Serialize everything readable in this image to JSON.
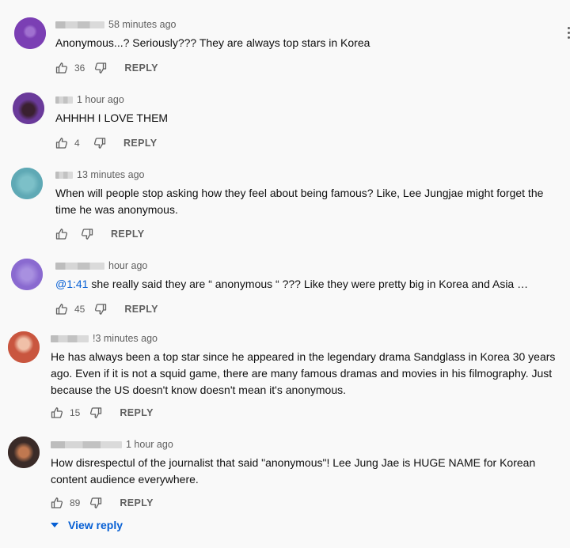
{
  "comments": [
    {
      "time": "58 minutes ago",
      "text": "Anonymous...? Seriously??? They are always top stars in Korea",
      "likes": "36",
      "reply_label": "REPLY",
      "avatar_color": "#7b3fb4"
    },
    {
      "time": "1 hour ago",
      "text": "AHHHH I LOVE THEM",
      "likes": "4",
      "reply_label": "REPLY",
      "avatar_color": "#6a3a9a"
    },
    {
      "time": "13 minutes ago",
      "text": "When will people stop asking how they feel about being famous? Like, Lee Jungjae might forget the\ntime he was anonymous.",
      "likes": "",
      "reply_label": "REPLY",
      "avatar_color": "#5fa9b5"
    },
    {
      "time": "hour ago",
      "timestamp_link": "@1:41",
      "text": " she really said they are “ anonymous “ ??? Like they were pretty big in Korea and Asia …",
      "likes": "45",
      "reply_label": "REPLY",
      "avatar_color": "#8a6ad0"
    },
    {
      "time": "!3 minutes ago",
      "text": "He has always been a top star since he appeared in the legendary drama Sandglass in Korea 30 years\nago. Even if it is not a squid game, there are many famous dramas and movies in his filmography. Just\nbecause the US doesn't know doesn't mean it's anonymous.",
      "likes": "15",
      "reply_label": "REPLY",
      "avatar_color": "#c9563f"
    },
    {
      "time": "1 hour ago",
      "text": "How disrespectul of the journalist that said \"anonymous\"! Lee Jung Jae is HUGE NAME for Korean\ncontent audience everywhere.",
      "likes": "89",
      "reply_label": "REPLY",
      "avatar_color": "#3a2b28"
    }
  ],
  "view_reply_label": "View reply",
  "icons": {
    "like": "thumbs-up-icon",
    "dislike": "thumbs-down-icon",
    "expand": "caret-down-icon"
  }
}
